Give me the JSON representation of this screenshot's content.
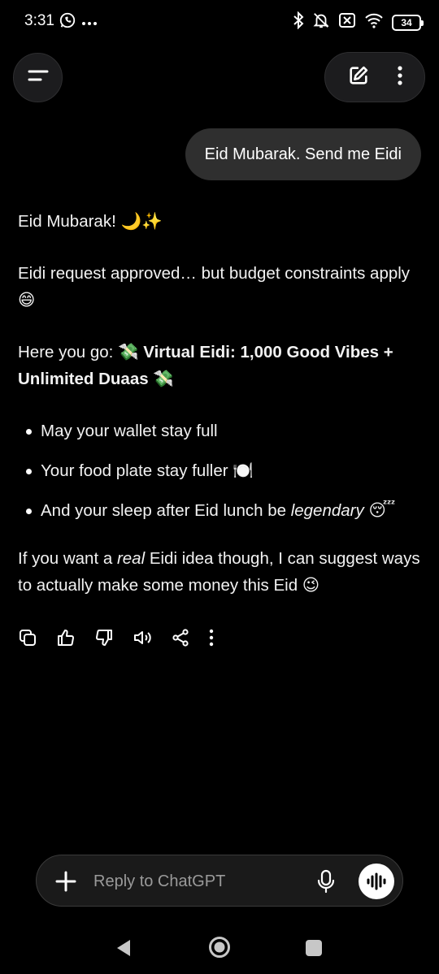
{
  "status": {
    "time": "3:31",
    "battery": "34",
    "left_icons": [
      "whatsapp-icon",
      "more-notifications-icon"
    ],
    "right_icons": [
      "bluetooth-icon",
      "mute-icon",
      "sim-off-icon",
      "wifi-icon",
      "battery-icon"
    ]
  },
  "header": {
    "menu_icon": "menu-icon",
    "new_chat_icon": "edit-icon",
    "more_icon": "more-vertical-icon"
  },
  "user_message": "Eid Mubarak. Send me Eidi",
  "assistant": {
    "greeting": "Eid Mubarak! 🌙✨",
    "line2": "Eidi request approved… but budget constraints apply 😄",
    "here_prefix": "Here you go: 💸 ",
    "here_bold": "Virtual Eidi: 1,000 Good Vibes + Unlimited Duaas",
    "here_suffix": " 💸",
    "bullets": [
      {
        "text": "May your wallet stay full"
      },
      {
        "text": "Your food plate stay fuller 🍽️"
      },
      {
        "pre": "And your sleep after Eid lunch be ",
        "em": "legendary",
        "post": " 😴"
      }
    ],
    "closing_pre": "If you want a ",
    "closing_em": "real",
    "closing_post": " Eidi idea though, I can suggest ways to actually make some money this Eid 😉"
  },
  "actions": [
    "copy-icon",
    "thumbs-up-icon",
    "thumbs-down-icon",
    "read-aloud-icon",
    "share-icon",
    "more-vertical-icon"
  ],
  "composer": {
    "placeholder": "Reply to ChatGPT",
    "value": ""
  },
  "colors": {
    "background": "#000000",
    "bubble": "#2f2f2f",
    "chip": "#1c1c1e",
    "placeholder": "#9a9a9a"
  }
}
